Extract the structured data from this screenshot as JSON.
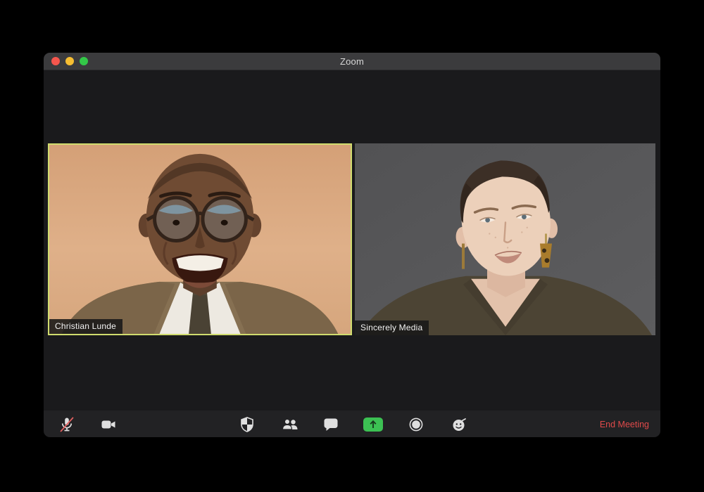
{
  "titlebar": {
    "title": "Zoom",
    "traffic_lights": [
      "close-button",
      "minimize-button",
      "fullscreen-button"
    ]
  },
  "tiles": [
    {
      "name": "Christian Lunde",
      "active_speaker": true
    },
    {
      "name": "Sincerely Media",
      "active_speaker": false
    }
  ],
  "toolbar": {
    "buttons": [
      {
        "icon": "microphone-muted-icon",
        "state": "muted"
      },
      {
        "icon": "video-camera-icon",
        "state": "on"
      },
      {
        "icon": "security-shield-icon"
      },
      {
        "icon": "participants-icon"
      },
      {
        "icon": "chat-bubble-icon"
      },
      {
        "icon": "share-screen-icon"
      },
      {
        "icon": "record-icon"
      },
      {
        "icon": "reactions-icon"
      }
    ],
    "end_meeting_label": "End Meeting"
  },
  "colors": {
    "active_tile_border": "#d0dc6e",
    "end_meeting_text": "#e04a4a",
    "share_button_green": "#3cc153",
    "mute_slash_red": "#e06060",
    "traffic_red": "#f5564d",
    "traffic_yellow": "#f6be32",
    "traffic_green": "#33c748",
    "titlebar_bg": "#3b3b3d",
    "content_bg": "#1a1a1c",
    "toolbar_bg": "#222224"
  }
}
